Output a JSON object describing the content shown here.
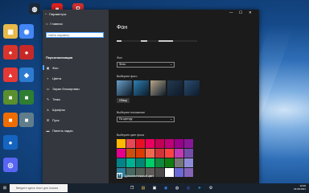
{
  "desktop": {
    "icons": [
      {
        "id": "folder",
        "glyph": "▦",
        "color": "#e8b84a"
      },
      {
        "id": "chrome",
        "glyph": "◉",
        "color": "#4285f4"
      },
      {
        "id": "app-red1",
        "glyph": "●",
        "color": "#d9342b"
      },
      {
        "id": "app-red2",
        "glyph": "●",
        "color": "#c62828"
      },
      {
        "id": "app-red3",
        "glyph": "▲",
        "color": "#e53935"
      },
      {
        "id": "app-blue",
        "glyph": "◆",
        "color": "#2d7bd1"
      },
      {
        "id": "minecraft",
        "glyph": "■",
        "color": "#5a8f2e"
      },
      {
        "id": "app-green",
        "glyph": "■",
        "color": "#2e7d32"
      },
      {
        "id": "app-orange",
        "glyph": "■",
        "color": "#ef6c00"
      },
      {
        "id": "app-grey",
        "glyph": "■",
        "color": "#607d8b"
      },
      {
        "id": "app-blue2",
        "glyph": "●",
        "color": "#1565c0"
      },
      {
        "id": "discord",
        "glyph": "◎",
        "color": "#5865f2"
      }
    ],
    "top_icons": [
      {
        "id": "steam",
        "glyph": "◍",
        "color": "#1b2838"
      },
      {
        "id": "roblox",
        "glyph": "■",
        "color": "#e02020"
      },
      {
        "id": "app-r",
        "glyph": "R",
        "color": "#d32f2f"
      }
    ]
  },
  "settings": {
    "window_title": "Параметры",
    "nav": {
      "home": "Главная",
      "search_placeholder": "Найти параметр",
      "section": "Персонализация",
      "items": [
        {
          "label": "Фон",
          "icon": "image-icon",
          "selected": true
        },
        {
          "label": "Цвета",
          "icon": "palette-icon"
        },
        {
          "label": "Экран блокировки",
          "icon": "lock-screen-icon"
        },
        {
          "label": "Темы",
          "icon": "brush-icon"
        },
        {
          "label": "Шрифты",
          "icon": "font-icon"
        },
        {
          "label": "Пуск",
          "icon": "start-icon"
        },
        {
          "label": "Панель задач",
          "icon": "taskbar-icon"
        }
      ]
    },
    "content": {
      "title": "Фон",
      "background_label": "Фон",
      "background_value": "Фото",
      "choose_photo_label": "Выберите фото",
      "browse_label": "Обзор",
      "fit_label": "Выберите положение",
      "fit_value": "По центру",
      "color_label": "Выберите цвет фона",
      "add_color_label": "Дополнительный цвет",
      "photos": [
        "#6a9fc7",
        "#2e7fb0",
        "#b7a58a",
        "#24384e",
        "#2b4d72"
      ],
      "colors": [
        [
          "#ffb900",
          "#e74856",
          "#e81123",
          "#ea005e",
          "#c30052",
          "#bf0077",
          "#9a0089",
          "#881798"
        ],
        [
          "#e3008c",
          "#ca5010",
          "#da3b01",
          "#ef6950",
          "#d13438",
          "#ff4343",
          "#c239b3",
          "#744da9"
        ],
        [
          "#038387",
          "#00b294",
          "#018574",
          "#00cc6a",
          "#10893e",
          "#107c10",
          "#767676",
          "#8e8cd8"
        ],
        [
          "#2d7d9a",
          "#486860",
          "#525e54",
          "#5d5a58",
          "#4c4a48",
          "#ffffff",
          "#6b69d6",
          "#8764b8"
        ]
      ]
    }
  },
  "taskbar": {
    "search_placeholder": "Введите здесь текст для поиска",
    "time": "10:06",
    "date": "18.08.2021",
    "apps": [
      "task-view-icon",
      "explorer-icon",
      "store-icon",
      "chrome-icon",
      "steam-icon",
      "discord-icon",
      "telegram-icon",
      "settings-icon"
    ]
  }
}
